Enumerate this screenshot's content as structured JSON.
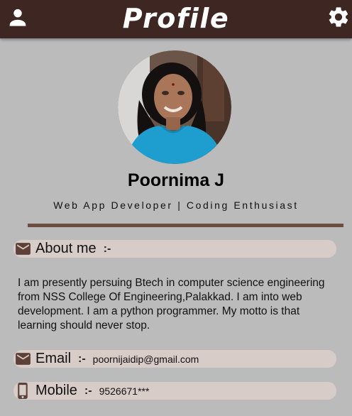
{
  "appbar": {
    "title": "Profile",
    "left_icon": "person-icon",
    "right_icon": "gear-icon",
    "color": "#3e2723"
  },
  "profile": {
    "avatar_icon": "profile-photo",
    "name": "Poornima J",
    "tagline": "Web App Developer | Coding Enthusiast"
  },
  "about": {
    "icon": "mail-icon",
    "label": "About me",
    "separator": ":-",
    "text": "I am presently persuing Btech in computer science engineering from NSS College Of Engineering,Palakkad. I am into web development. I am a python programmer. My motto is that learning should never stop."
  },
  "email": {
    "icon": "mail-icon",
    "label": "Email",
    "separator": ":-",
    "value": "poornijaidip@gmail.com"
  },
  "mobile": {
    "icon": "phone-icon",
    "label": "Mobile",
    "separator": ":-",
    "value": "9526671***"
  },
  "colors": {
    "background": "#bbbbbb",
    "pill": "#d7ccc8",
    "divider": "#6d4c41"
  }
}
